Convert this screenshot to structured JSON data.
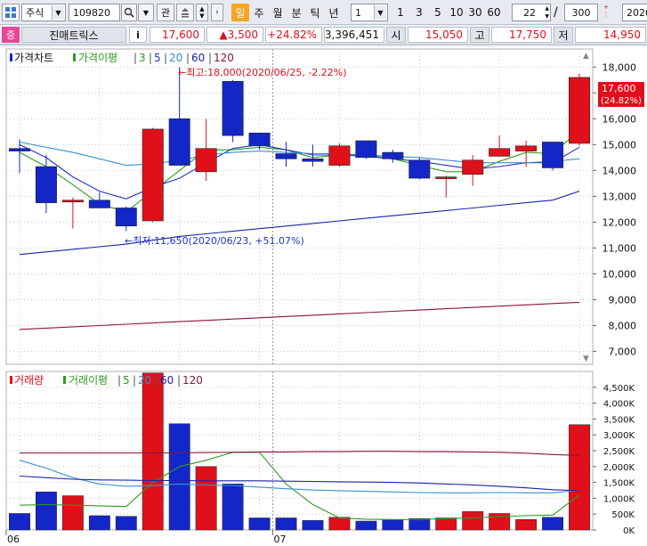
{
  "toolbar": {
    "market_type": "주식",
    "stock_code": "109820",
    "favorites_label": "관",
    "periods": [
      "일",
      "주",
      "월",
      "분",
      "틱",
      "년"
    ],
    "active_period": "일",
    "interval_value": "1",
    "interval_presets": [
      "1",
      "3",
      "5",
      "10",
      "30",
      "60"
    ],
    "count_value": "22",
    "total_value": "300",
    "date_value": "2020"
  },
  "quote": {
    "badge": "증",
    "name": "진매트릭스",
    "info_label": "i",
    "price": "17,600",
    "change": "▲3,500",
    "change_pct": "+24.82%",
    "volume": "3,396,451",
    "open_label": "시",
    "open": "15,050",
    "high_label": "고",
    "high": "17,750",
    "low_label": "저",
    "low": "14,950"
  },
  "price_panel": {
    "title": "가격차트",
    "legend_ma_label": "가격이평",
    "legend_periods": [
      "3",
      "5",
      "20",
      "60",
      "120"
    ],
    "legend_colors": [
      "#2e9a22",
      "#1f34c8",
      "#3a8fd0",
      "#1d23a8",
      "#8a1535"
    ],
    "high_note": "←최고:18,000(2020/06/25, -2.22%)",
    "low_note": "←최저:11,650(2020/06/23, +51.07%)",
    "last_price_tag": "17,600",
    "last_pct_tag": "(24.82%)"
  },
  "volume_panel": {
    "title": "거래량",
    "legend_ma_label": "거래이평",
    "legend_periods": [
      "5",
      "20",
      "60",
      "120"
    ],
    "legend_colors": [
      "#2e9a22",
      "#3a8fd0",
      "#1d23a8",
      "#8a1535"
    ]
  },
  "x_axis": {
    "month_labels": [
      {
        "label": "06",
        "index": 0
      },
      {
        "label": "07",
        "index": 10
      }
    ]
  },
  "colors": {
    "up": "#e0101a",
    "down": "#1426c8",
    "grid": "#c8c8c8"
  },
  "chart_data": [
    {
      "type": "candlestick",
      "title": "가격차트",
      "ylim": [
        6500,
        18700
      ],
      "y_ticks": [
        7000,
        8000,
        9000,
        10000,
        11000,
        12000,
        13000,
        14000,
        15000,
        16000,
        17000,
        18000
      ],
      "candles": [
        {
          "o": 14850,
          "h": 15200,
          "l": 13900,
          "c": 14750
        },
        {
          "o": 14150,
          "h": 14600,
          "l": 12350,
          "c": 12750
        },
        {
          "o": 12850,
          "h": 12950,
          "l": 11750,
          "c": 12850
        },
        {
          "o": 12850,
          "h": 13150,
          "l": 12550,
          "c": 12550
        },
        {
          "o": 12550,
          "h": 12600,
          "l": 11650,
          "c": 11850
        },
        {
          "o": 12050,
          "h": 15650,
          "l": 12000,
          "c": 15600
        },
        {
          "o": 16000,
          "h": 18000,
          "l": 14200,
          "c": 14200
        },
        {
          "o": 13950,
          "h": 16000,
          "l": 13600,
          "c": 14850
        },
        {
          "o": 17450,
          "h": 17500,
          "l": 15100,
          "c": 15350
        },
        {
          "o": 15450,
          "h": 15450,
          "l": 14800,
          "c": 14950
        },
        {
          "o": 14650,
          "h": 15100,
          "l": 14150,
          "c": 14450
        },
        {
          "o": 14450,
          "h": 15000,
          "l": 14150,
          "c": 14350
        },
        {
          "o": 14200,
          "h": 15050,
          "l": 14150,
          "c": 14950
        },
        {
          "o": 15150,
          "h": 15150,
          "l": 14450,
          "c": 14500
        },
        {
          "o": 14700,
          "h": 14800,
          "l": 14300,
          "c": 14450
        },
        {
          "o": 14400,
          "h": 14500,
          "l": 13650,
          "c": 13700
        },
        {
          "o": 13750,
          "h": 13800,
          "l": 12950,
          "c": 13750
        },
        {
          "o": 13850,
          "h": 14600,
          "l": 13400,
          "c": 14400
        },
        {
          "o": 14550,
          "h": 15350,
          "l": 14550,
          "c": 14850
        },
        {
          "o": 14750,
          "h": 15150,
          "l": 14150,
          "c": 14950
        },
        {
          "o": 15100,
          "h": 15100,
          "l": 14000,
          "c": 14100
        },
        {
          "o": 15050,
          "h": 17750,
          "l": 14950,
          "c": 17600
        }
      ],
      "ma": {
        "3": [
          14700,
          14150,
          13450,
          12700,
          12400,
          13200,
          14000,
          14800,
          14800,
          14900,
          14800,
          14500,
          14600,
          14600,
          14450,
          14200,
          13950,
          13950,
          14350,
          14700,
          14650,
          15550
        ],
        "5": [
          15000,
          14500,
          13750,
          13200,
          12900,
          13350,
          13700,
          14300,
          14850,
          15000,
          14800,
          14600,
          14600,
          14550,
          14450,
          14350,
          14200,
          14050,
          14150,
          14300,
          14300,
          14900
        ],
        "20": [
          15100,
          14900,
          14700,
          14450,
          14200,
          14250,
          14400,
          14600,
          14700,
          14750,
          14700,
          14650,
          14650,
          14600,
          14550,
          14500,
          14400,
          14300,
          14300,
          14300,
          14350,
          14450
        ],
        "60": [
          10750,
          10850,
          10950,
          11050,
          11150,
          11300,
          11450,
          11550,
          11650,
          11750,
          11850,
          11950,
          12050,
          12150,
          12250,
          12350,
          12450,
          12550,
          12650,
          12750,
          12850,
          13200
        ],
        "120": [
          7850,
          7900,
          7950,
          8000,
          8050,
          8100,
          8150,
          8200,
          8250,
          8300,
          8350,
          8400,
          8450,
          8500,
          8550,
          8600,
          8650,
          8700,
          8750,
          8800,
          8850,
          8900
        ]
      }
    },
    {
      "type": "bar",
      "title": "거래량",
      "ylim": [
        0,
        5000000
      ],
      "y_ticks": [
        0,
        500000,
        1000000,
        1500000,
        2000000,
        2500000,
        3000000,
        3500000,
        4000000,
        4500000
      ],
      "y_tick_labels": [
        "0K",
        "500K",
        "1,000K",
        "1,500K",
        "2,000K",
        "2,500K",
        "3,000K",
        "3,500K",
        "4,000K",
        "4,500K"
      ],
      "volumes": [
        520000,
        1200000,
        1080000,
        450000,
        430000,
        4950000,
        3350000,
        2000000,
        1450000,
        380000,
        380000,
        300000,
        400000,
        280000,
        320000,
        360000,
        380000,
        580000,
        520000,
        330000,
        400000,
        3320000
      ],
      "ma": {
        "5": [
          780000,
          800000,
          780000,
          760000,
          740000,
          1500000,
          2000000,
          2200000,
          2450000,
          2450000,
          1450000,
          800000,
          380000,
          340000,
          330000,
          330000,
          360000,
          380000,
          420000,
          450000,
          470000,
          1100000
        ],
        "20": [
          2200000,
          1950000,
          1650000,
          1450000,
          1380000,
          1400000,
          1450000,
          1420000,
          1400000,
          1350000,
          1300000,
          1260000,
          1240000,
          1220000,
          1200000,
          1180000,
          1170000,
          1170000,
          1180000,
          1170000,
          1170000,
          1250000
        ],
        "60": [
          1700000,
          1650000,
          1600000,
          1580000,
          1570000,
          1560000,
          1560000,
          1550000,
          1550000,
          1550000,
          1540000,
          1530000,
          1520000,
          1510000,
          1500000,
          1480000,
          1450000,
          1420000,
          1380000,
          1330000,
          1270000,
          1240000
        ],
        "120": [
          2430000,
          2430000,
          2430000,
          2430000,
          2430000,
          2430000,
          2430000,
          2440000,
          2450000,
          2460000,
          2460000,
          2470000,
          2470000,
          2480000,
          2480000,
          2470000,
          2470000,
          2460000,
          2450000,
          2420000,
          2380000,
          2350000
        ]
      }
    }
  ]
}
